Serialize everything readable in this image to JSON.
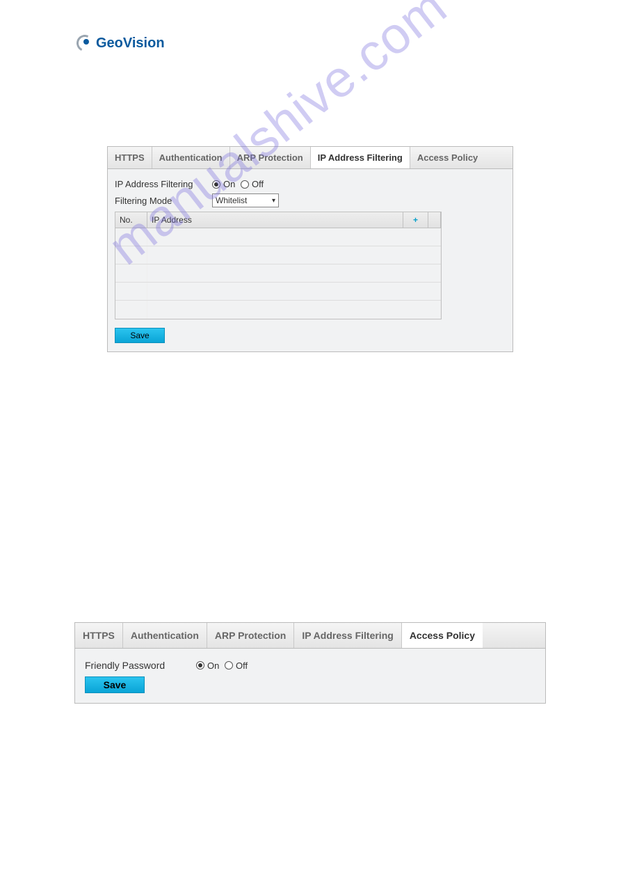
{
  "logo": {
    "text": "GeoVision"
  },
  "watermark": "manualshive.com",
  "panel1": {
    "tabs": [
      "HTTPS",
      "Authentication",
      "ARP Protection",
      "IP Address Filtering",
      "Access Policy"
    ],
    "active_tab_index": 3,
    "fields": {
      "ip_filtering_label": "IP Address Filtering",
      "on_label": "On",
      "off_label": "Off",
      "ip_filtering_value": "On",
      "filtering_mode_label": "Filtering Mode",
      "filtering_mode_value": "Whitelist"
    },
    "grid": {
      "headers": {
        "no": "No.",
        "ip": "IP Address"
      },
      "rows": [
        "",
        "",
        "",
        "",
        ""
      ]
    },
    "save_label": "Save"
  },
  "panel2": {
    "tabs": [
      "HTTPS",
      "Authentication",
      "ARP Protection",
      "IP Address Filtering",
      "Access Policy"
    ],
    "active_tab_index": 4,
    "fields": {
      "friendly_password_label": "Friendly Password",
      "on_label": "On",
      "off_label": "Off",
      "friendly_password_value": "On"
    },
    "save_label": "Save"
  }
}
